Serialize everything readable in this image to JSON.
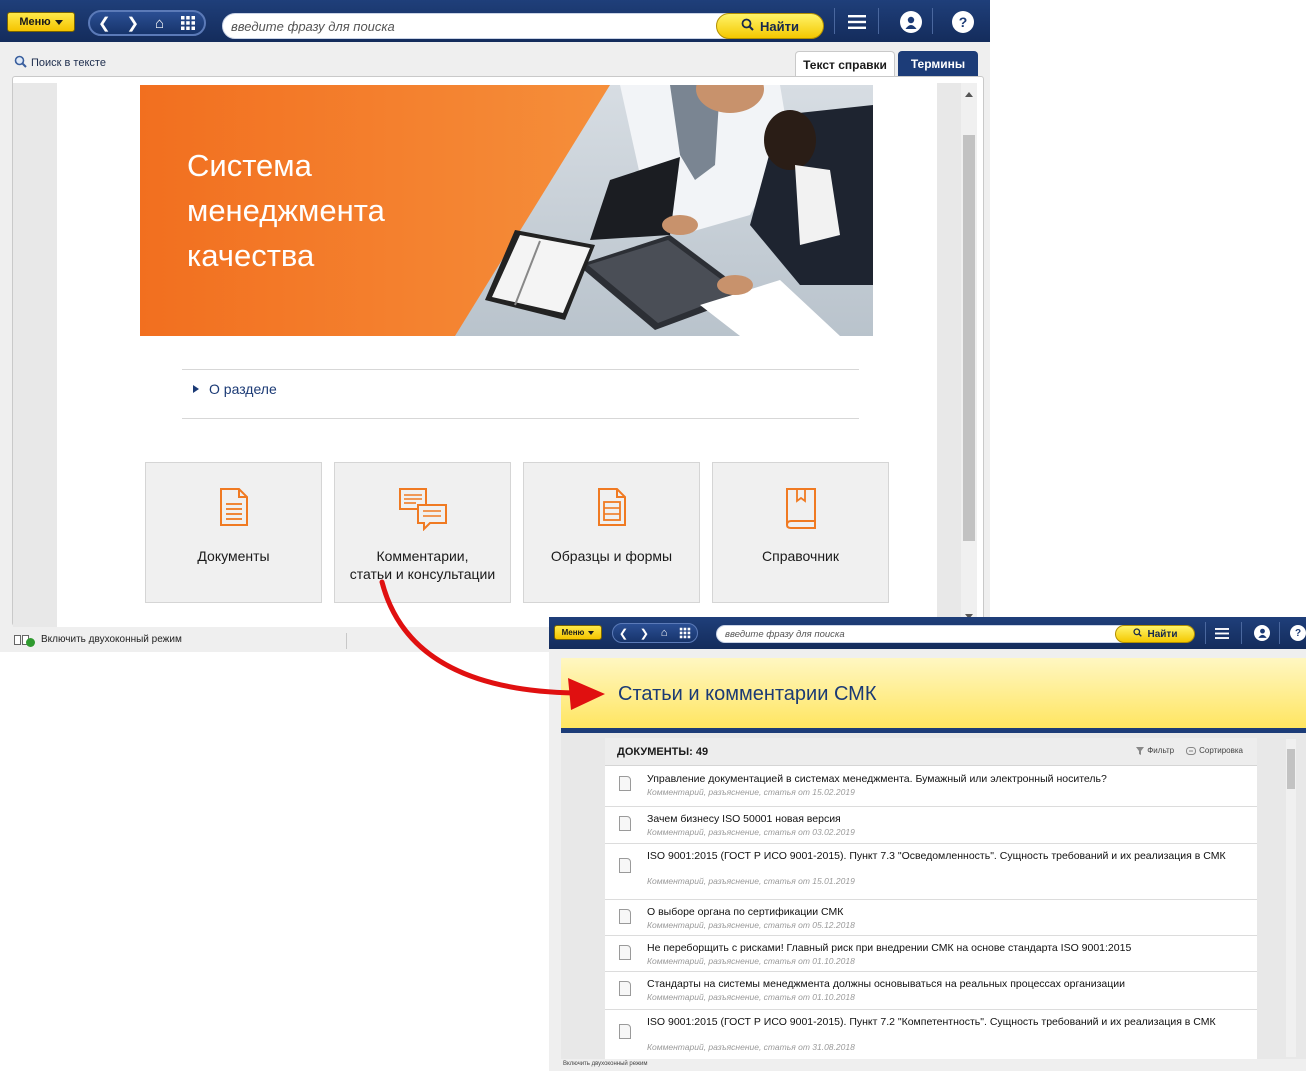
{
  "toolbar": {
    "menu_label": "Меню",
    "search_placeholder": "введите фразу для поиска",
    "find_label": "Найти"
  },
  "main_window": {
    "text_search_label": "Поиск в тексте",
    "tabs": [
      {
        "label": "Текст справки",
        "active": true
      },
      {
        "label": "Термины",
        "active": false
      }
    ],
    "banner": {
      "title_lines": [
        "Система",
        "менеджмента",
        "качества"
      ]
    },
    "about_link": "О разделе",
    "cards": [
      {
        "label": "Документы",
        "icon": "document-icon"
      },
      {
        "label_lines": [
          "Комментарии,",
          "статьи и консультации"
        ],
        "icon": "comments-icon"
      },
      {
        "label": "Образцы и формы",
        "icon": "forms-icon"
      },
      {
        "label": "Справочник",
        "icon": "book-icon"
      }
    ],
    "status_text": "Включить двухоконный режим"
  },
  "second_window": {
    "title": "Статьи и комментарии СМК",
    "documents_count_label": "ДОКУМЕНТЫ: 49",
    "filter_label": "Фильтр",
    "sort_label": "Сортировка",
    "documents": [
      {
        "title": "Управление документацией в системах менеджмента. Бумажный или электронный носитель?",
        "meta": "Комментарий, разъяснение, статья от 15.02.2019"
      },
      {
        "title": "Зачем бизнесу ISO 50001 новая версия",
        "meta": "Комментарий, разъяснение, статья от 03.02.2019"
      },
      {
        "title": "ISO 9001:2015 (ГОСТ Р ИСО 9001-2015). Пункт 7.3 \"Осведомленность\". Сущность требований и их реализация в СМК",
        "meta": "Комментарий, разъяснение, статья от 15.01.2019"
      },
      {
        "title": "О выборе органа по сертификации СМК",
        "meta": "Комментарий, разъяснение, статья от 05.12.2018"
      },
      {
        "title": "Не переборщить с рисками! Главный риск при внедрении СМК на основе стандарта ISO 9001:2015",
        "meta": "Комментарий, разъяснение, статья от 01.10.2018"
      },
      {
        "title": "Стандарты на системы менеджмента должны основываться на реальных процессах организации",
        "meta": "Комментарий, разъяснение, статья от 01.10.2018"
      },
      {
        "title": "ISO 9001:2015 (ГОСТ Р ИСО 9001-2015). Пункт 7.2 \"Компетентность\". Сущность требований и их реализация в СМК",
        "meta": "Комментарий, разъяснение, статья от 31.08.2018"
      }
    ],
    "status_text": "Включить двухоконный режим"
  },
  "colors": {
    "navy": "#1c3c78",
    "accent_orange": "#f58a2a",
    "accent_yellow": "#f5c400",
    "arrow_red": "#e01010"
  }
}
